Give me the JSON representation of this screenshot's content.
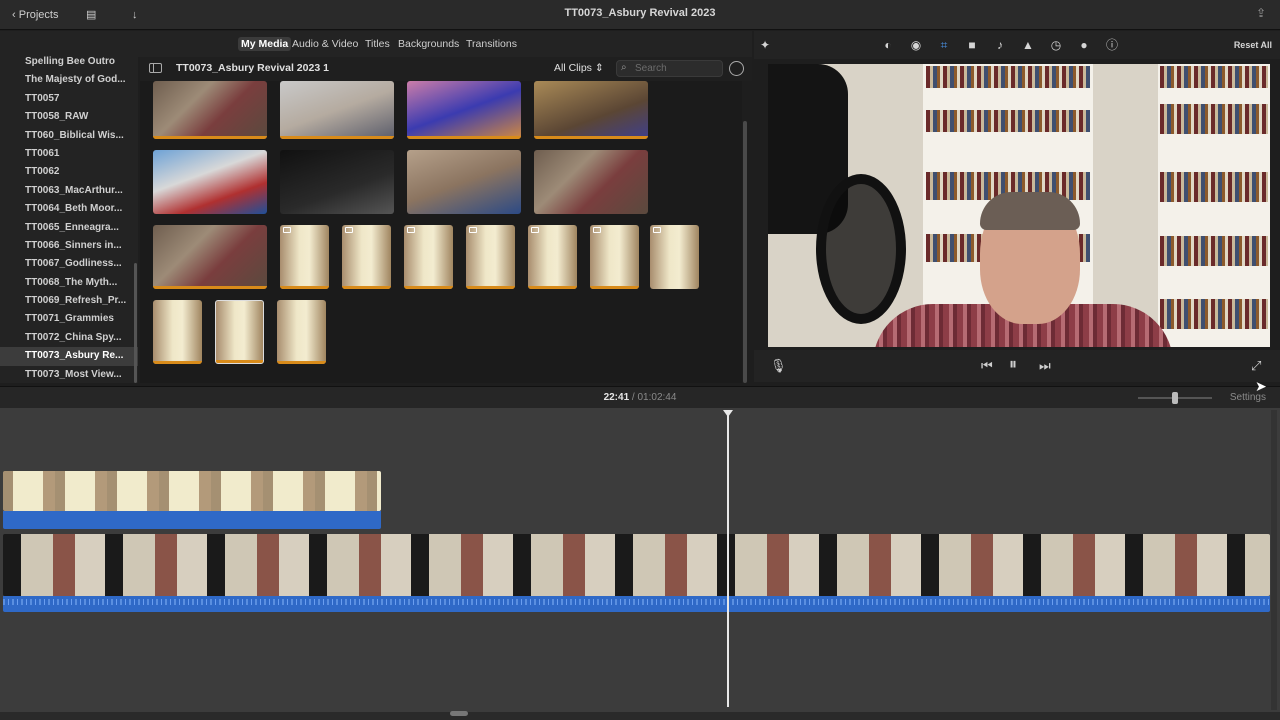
{
  "titlebar": {
    "projects_label": "Projects",
    "title": "TT0073_Asbury Revival 2023",
    "icons": [
      "chevron-left-icon",
      "library-list-icon",
      "import-arrow-icon",
      "share-icon"
    ]
  },
  "browser_tabs": [
    {
      "label": "My Media",
      "active": true
    },
    {
      "label": "Audio & Video",
      "active": false
    },
    {
      "label": "Titles",
      "active": false
    },
    {
      "label": "Backgrounds",
      "active": false
    },
    {
      "label": "Transitions",
      "active": false
    }
  ],
  "library": {
    "items": [
      "Spelling Bee Outro",
      "The Majesty of God...",
      "TT0057",
      "TT0058_RAW",
      "TT060_Biblical Wis...",
      "TT0061",
      "TT0062",
      "TT0063_MacArthur...",
      "TT0064_Beth Moor...",
      "TT0065_Enneagra...",
      "TT0066_Sinners in...",
      "TT0067_Godliness...",
      "TT0068_The Myth...",
      "TT0069_Refresh_Pr...",
      "TT0071_Grammies",
      "TT0072_China Spy...",
      "TT0073_Asbury Re...",
      "TT0073_Most View..."
    ],
    "selected_index": 16
  },
  "media_browser": {
    "event_title": "TT0073_Asbury Revival 2023 1",
    "filter": "All Clips",
    "search_placeholder": "Search",
    "thumbnail_rows": [
      [
        "office",
        "zoom",
        "news",
        "cam"
      ],
      [
        "tv",
        "dark",
        "hall",
        "office"
      ],
      [
        "office",
        "candle",
        "candle",
        "candle",
        "candle",
        "candle",
        "candle",
        "candle"
      ],
      [
        "candle",
        "candle",
        "candle"
      ]
    ]
  },
  "viewer_toolbar": {
    "tools": [
      "magic-wand-icon",
      "color-balance-icon",
      "color-correction-icon",
      "crop-icon",
      "stabilization-icon",
      "volume-icon",
      "noise-reduction-icon",
      "speed-icon",
      "clip-filter-icon",
      "info-icon"
    ],
    "active_tool": "crop-icon",
    "reset_label": "Reset All"
  },
  "viewer_controls": {
    "icons": [
      "microphone-icon",
      "skip-back-icon",
      "pause-icon",
      "skip-forward-icon",
      "fullscreen-icon"
    ]
  },
  "timeline": {
    "current_time": "22:41",
    "separator": "/",
    "total_time": "01:02:44",
    "settings_label": "Settings"
  }
}
